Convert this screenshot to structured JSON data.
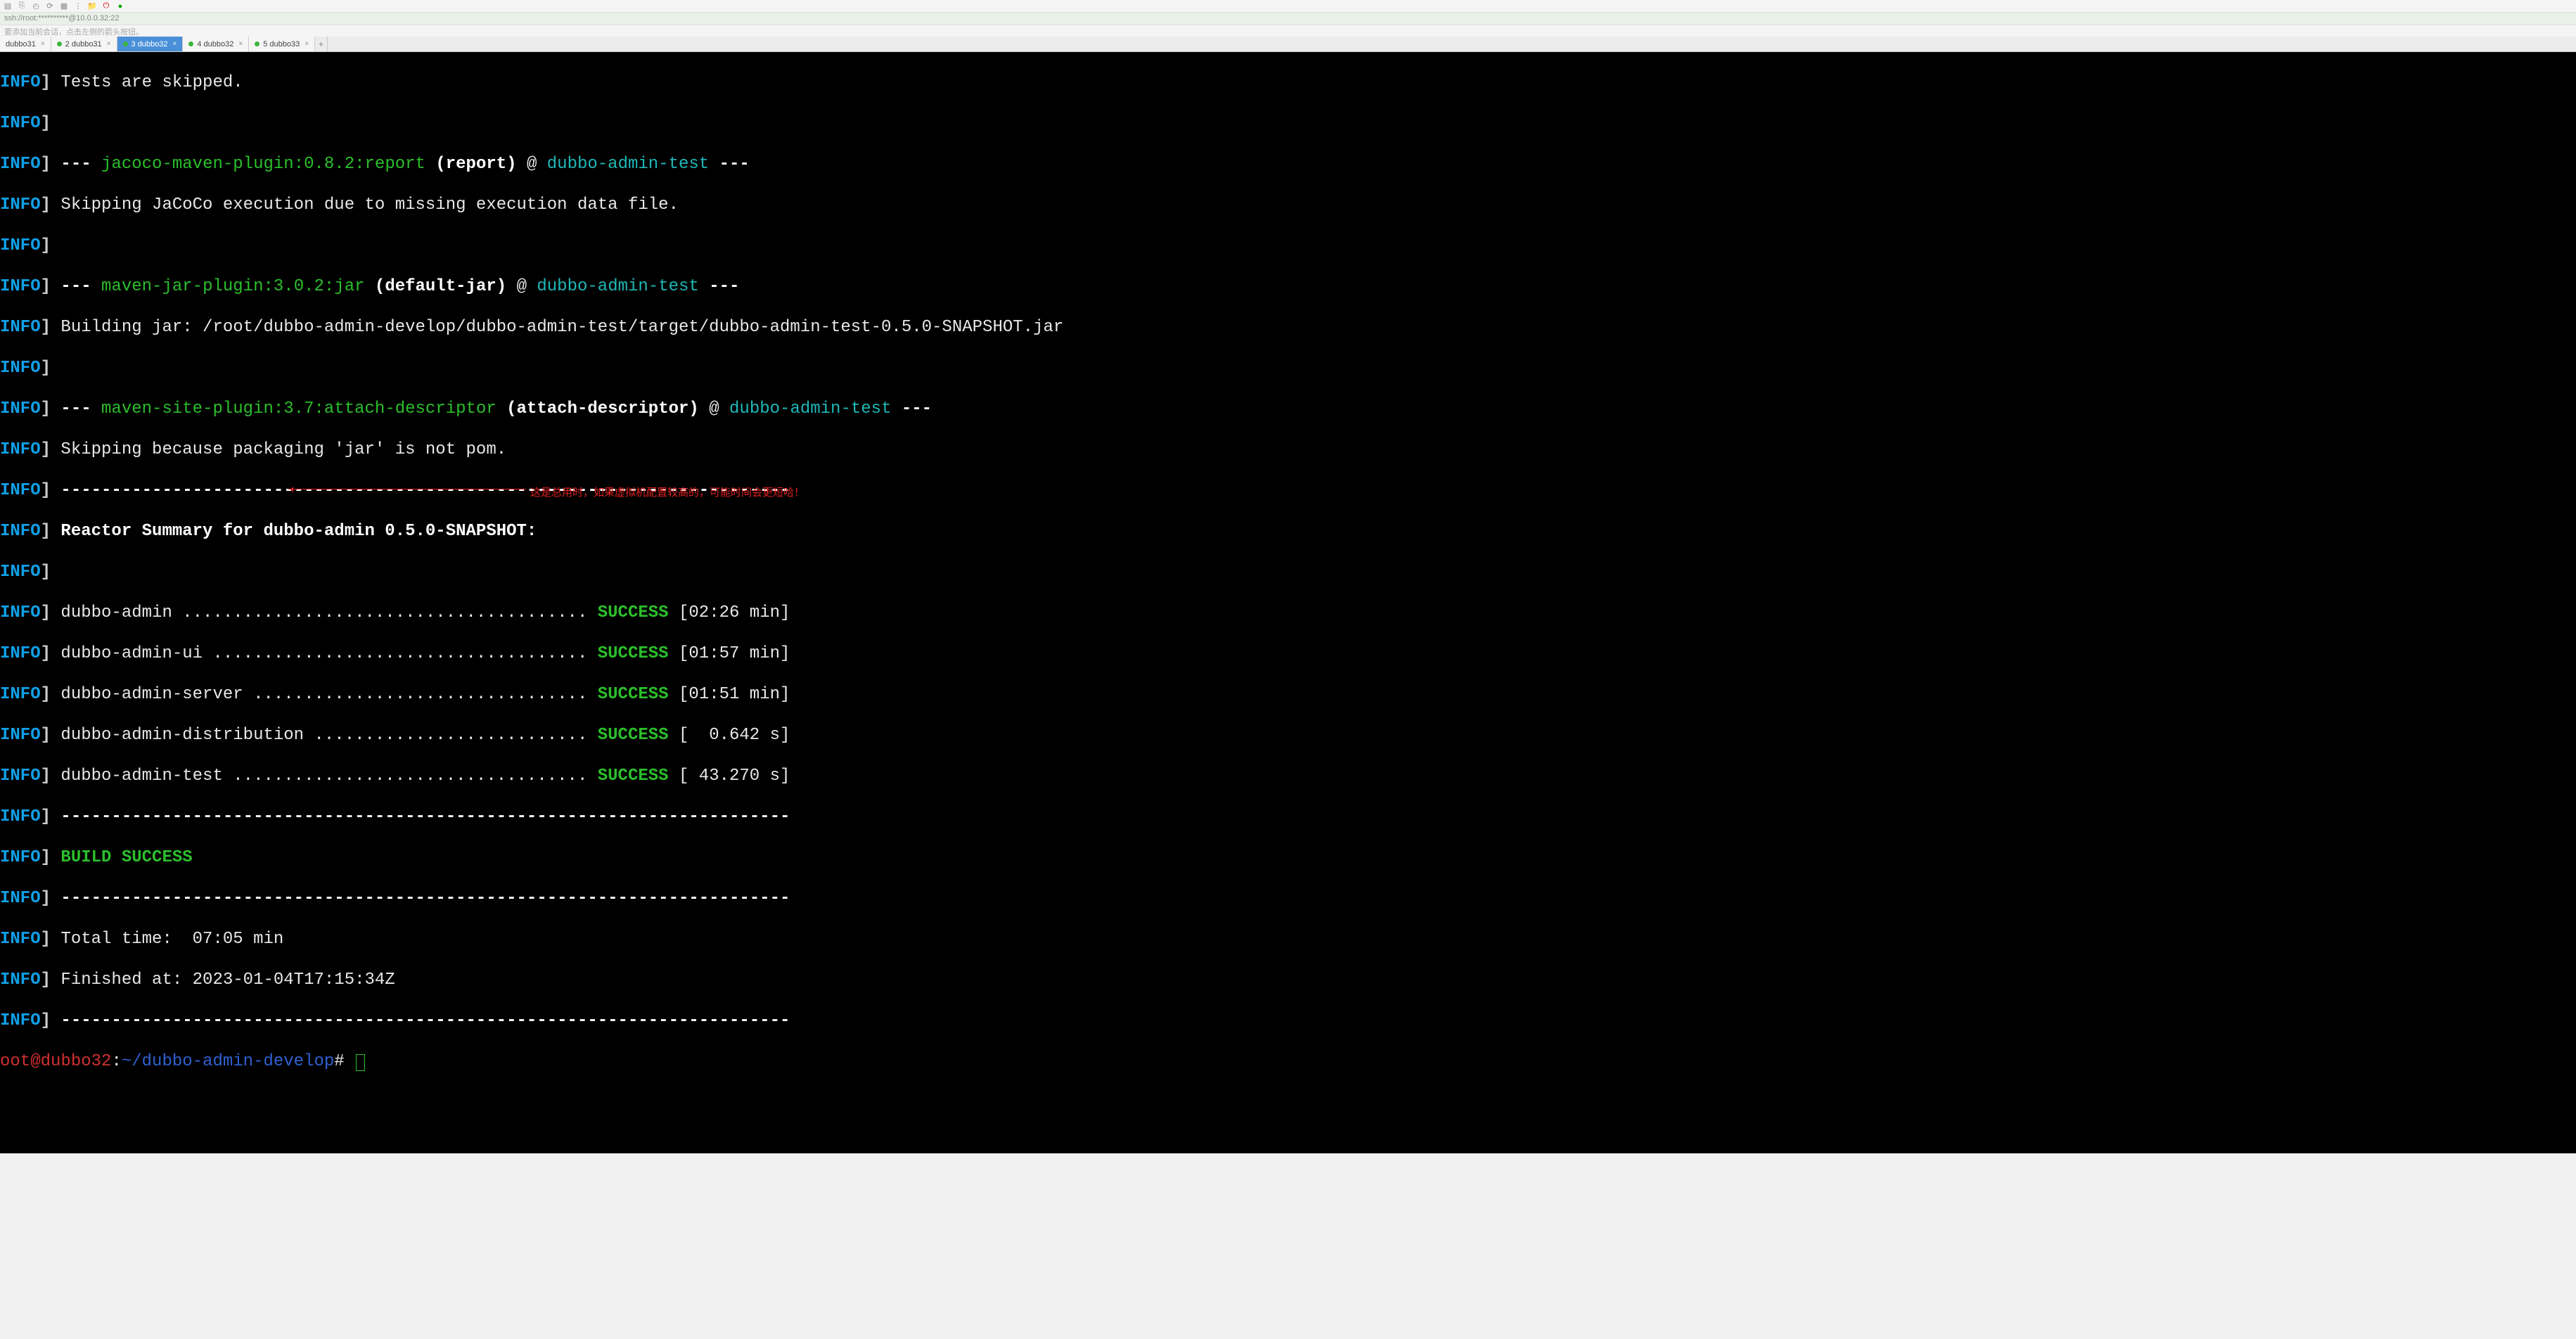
{
  "ssh_line": "ssh://root:**********@10.0.0.32:22",
  "hint_line": "要添加当前会话，点击左侧的箭头按钮。",
  "tabs": [
    {
      "label": "dubbo31",
      "dot": false
    },
    {
      "label": "2 dubbo31",
      "dot": true
    },
    {
      "label": "3 dubbo32",
      "dot": true,
      "active": true
    },
    {
      "label": "4 dubbo32",
      "dot": true
    },
    {
      "label": "5 dubbo33",
      "dot": true
    }
  ],
  "term": {
    "tests_skipped": "Tests are skipped.",
    "plugin1": "jacoco-maven-plugin:0.8.2:report",
    "goal1": "(report)",
    "at": "@",
    "mod_test": "dubbo-admin-test",
    "dashes3": "---",
    "jacoco_skip": "Skipping JaCoCo execution due to missing execution data file.",
    "plugin2": "maven-jar-plugin:3.0.2:jar",
    "goal2": "(default-jar)",
    "building_jar": "Building jar: /root/dubbo-admin-develop/dubbo-admin-test/target/dubbo-admin-test-0.5.0-SNAPSHOT.jar",
    "plugin3": "maven-site-plugin:3.7:attach-descriptor",
    "goal3": "(attach-descriptor)",
    "skip_pom": "Skipping because packaging 'jar' is not pom.",
    "sep": "------------------------------------------------------------------------",
    "reactor": "Reactor Summary for dubbo-admin 0.5.0-SNAPSHOT:",
    "row1_name": "dubbo-admin ........................................",
    "row2_name": "dubbo-admin-ui .....................................",
    "row3_name": "dubbo-admin-server .................................",
    "row4_name": "dubbo-admin-distribution ...........................",
    "row5_name": "dubbo-admin-test ...................................",
    "success": "SUCCESS",
    "row1_time": "[02:26 min]",
    "row2_time": "[01:57 min]",
    "row3_time": "[01:51 min]",
    "row4_time": "[  0.642 s]",
    "row5_time": "[ 43.270 s]",
    "build_success": "BUILD SUCCESS",
    "total_time": "Total time:  07:05 min",
    "finished": "Finished at: 2023-01-04T17:15:34Z",
    "prompt_user": "oot@dubbo32",
    "prompt_colon": ":",
    "prompt_path": "~/dubbo-admin-develop",
    "prompt_end": "# "
  },
  "annotation_text": "这是总用时，如果虚拟机配置较高的，可能时间会更短哈！"
}
